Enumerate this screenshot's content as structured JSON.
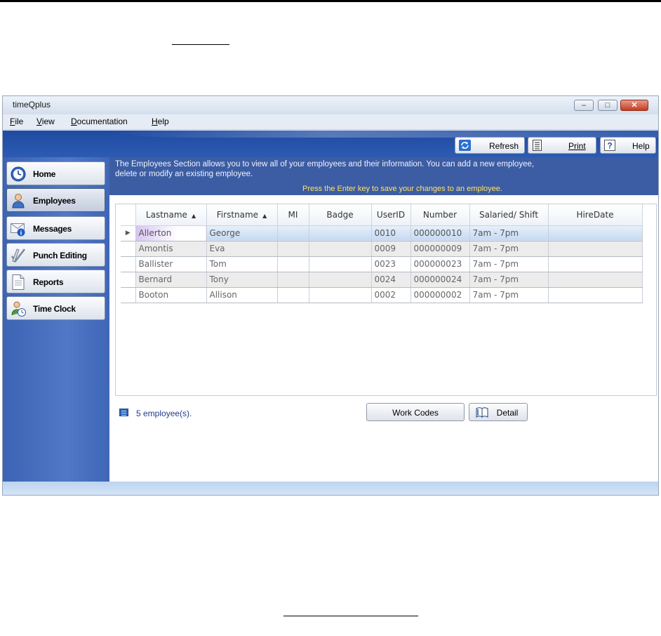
{
  "window": {
    "title": "timeQplus",
    "controls": {
      "minimize": "–",
      "maximize": "□",
      "close": "✕"
    }
  },
  "menu": [
    {
      "underline": "F",
      "rest": "ile"
    },
    {
      "underline": "V",
      "rest": "iew"
    },
    {
      "underline": "D",
      "rest": "ocumentation"
    },
    {
      "underline": "H",
      "rest": "elp"
    }
  ],
  "toolbar": {
    "refresh_label": "Refresh",
    "print_label": "Print",
    "help_label": "Help"
  },
  "sidebar": {
    "items": [
      {
        "label": "Home",
        "icon": "clock-icon"
      },
      {
        "label": "Employees",
        "icon": "person-icon",
        "active": true
      },
      {
        "label": "Messages",
        "icon": "envelope-icon"
      },
      {
        "label": "Punch Editing",
        "icon": "checkmark-pencil-icon"
      },
      {
        "label": "Reports",
        "icon": "document-icon"
      },
      {
        "label": "Time Clock",
        "icon": "person-clock-icon"
      }
    ]
  },
  "info": {
    "line1": "The Employees Section allows you to view all of your employees and their information.  You can add a new employee, delete or modify an existing employee.",
    "line2": "Press the Enter key to save your changes to an employee."
  },
  "grid": {
    "columns": [
      "Lastname",
      "Firstname",
      "MI",
      "Badge",
      "UserID",
      "Number",
      "Salaried/ Shift",
      "HireDate"
    ],
    "sorted_columns": [
      "Lastname",
      "Firstname"
    ],
    "rows": [
      {
        "lastname": "Allerton",
        "firstname": "George",
        "mi": "",
        "badge": "",
        "userid": "0010",
        "number": "000000010",
        "shift": "7am - 7pm",
        "hiredate": ""
      },
      {
        "lastname": "Amontis",
        "firstname": "Eva",
        "mi": "",
        "badge": "",
        "userid": "0009",
        "number": "000000009",
        "shift": "7am - 7pm",
        "hiredate": ""
      },
      {
        "lastname": "Ballister",
        "firstname": "Tom",
        "mi": "",
        "badge": "",
        "userid": "0023",
        "number": "000000023",
        "shift": "7am - 7pm",
        "hiredate": ""
      },
      {
        "lastname": "Bernard",
        "firstname": "Tony",
        "mi": "",
        "badge": "",
        "userid": "0024",
        "number": "000000024",
        "shift": "7am - 7pm",
        "hiredate": ""
      },
      {
        "lastname": "Booton",
        "firstname": "Allison",
        "mi": "",
        "badge": "",
        "userid": "0002",
        "number": "000000002",
        "shift": "7am - 7pm",
        "hiredate": ""
      }
    ],
    "selected_row_marker": "▶"
  },
  "footer": {
    "count_text": "5 employee(s).",
    "work_codes_label": "Work Codes",
    "detail_label": "Detail"
  },
  "colors": {
    "nav_blue": "#3d63b4",
    "info_blue": "#3c5da3",
    "info_highlight": "#ffe06a",
    "close_red": "#c53b21"
  }
}
